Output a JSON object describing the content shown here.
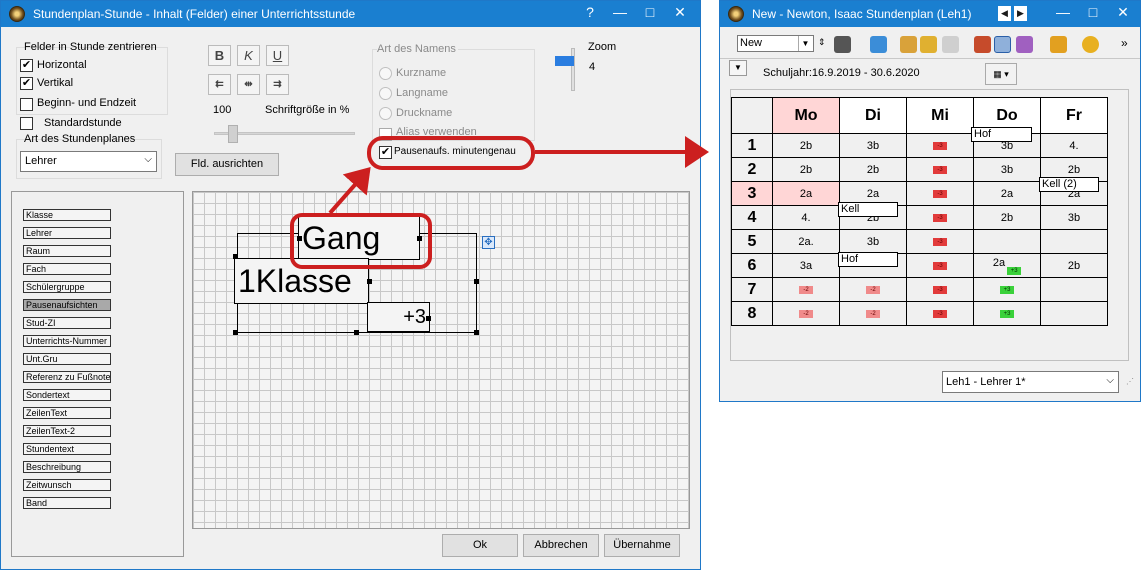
{
  "left_window": {
    "title": "Stundenplan-Stunde - Inhalt (Felder) einer Unterrichtsstunde",
    "window_buttons": {
      "help": "?",
      "minimize": "—",
      "maximize": "□",
      "close": "✕"
    },
    "center_group_title": "Felder in Stunde zentrieren",
    "horizontal_label": "Horizontal",
    "vertical_label": "Vertikal",
    "begin_end_label": "Beginn- und Endzeit",
    "standard_label": "Standardstunde",
    "plan_type_label": "Art des Stundenplanes",
    "plan_type_value": "Lehrer",
    "format_buttons": {
      "bold": "B",
      "italic": "K",
      "underline": "U"
    },
    "font_size_value": "100",
    "font_size_label": "Schriftgröße in %",
    "align_button": "Fld. ausrichten",
    "name_type_title": "Art des Namens",
    "radio_short": "Kurzname",
    "radio_long": "Langname",
    "radio_print": "Druckname",
    "alias_label": "Alias verwenden",
    "break_label": "Pausenaufs. minutengenau",
    "zoom_label": "Zoom",
    "zoom_value": "4",
    "fields": [
      "Klasse",
      "Lehrer",
      "Raum",
      "Fach",
      "Schülergruppe",
      "Pausenaufsichten",
      "Stud-ZI",
      "Unterrichts-Nummer",
      "Unt.Gru",
      "Referenz zu Fußnote",
      "Sondertext",
      "ZeilenText",
      "ZeilenText-2",
      "Stundentext",
      "Beschreibung",
      "Zeitwunsch",
      "Band"
    ],
    "selected_field": "Pausenaufsichten",
    "preview": {
      "gang": "Gang",
      "klasse": "1Klasse",
      "plus": "+3"
    },
    "ok_button": "Ok",
    "cancel_button": "Abbrechen",
    "apply_button": "Übernahme"
  },
  "right_window": {
    "title": "New - Newton, Isaac  Stundenplan  (Leh1)",
    "format_select": "New",
    "schoolyear": "Schuljahr:16.9.2019 - 30.6.2020",
    "days": [
      "Mo",
      "Di",
      "Mi",
      "Do",
      "Fr"
    ],
    "rows": [
      {
        "n": "1",
        "cells": [
          "2b",
          "3b",
          "-3",
          "3b",
          "4."
        ]
      },
      {
        "n": "2",
        "cells": [
          "2b",
          "2b",
          "-3",
          "3b",
          "2b"
        ]
      },
      {
        "n": "3",
        "cells": [
          "2a",
          "2a",
          "-3",
          "2a",
          "2a"
        ]
      },
      {
        "n": "4",
        "cells": [
          "4.",
          "2b",
          "-3",
          "2b",
          "3b"
        ]
      },
      {
        "n": "5",
        "cells": [
          "2a.",
          "3b",
          "-3",
          "",
          ""
        ]
      },
      {
        "n": "6",
        "cells": [
          "3a",
          "",
          "-3",
          "2a",
          "2b"
        ]
      },
      {
        "n": "7",
        "cells": [
          "-2",
          "-2",
          "-3",
          "+3",
          ""
        ]
      },
      {
        "n": "8",
        "cells": [
          "-2",
          "-2",
          "-3",
          "+3",
          ""
        ]
      }
    ],
    "badge_do6": "+3",
    "popups": {
      "hof1": "Hof",
      "kell2": "Kell (2)",
      "kell": "Kell",
      "hof2": "Hof"
    },
    "teacher_select": "Leh1 - Lehrer 1*"
  },
  "colors": {
    "titlebar": "#1a7fd0",
    "highlight": "#cc1f1f",
    "today": "#ffd6d6"
  }
}
